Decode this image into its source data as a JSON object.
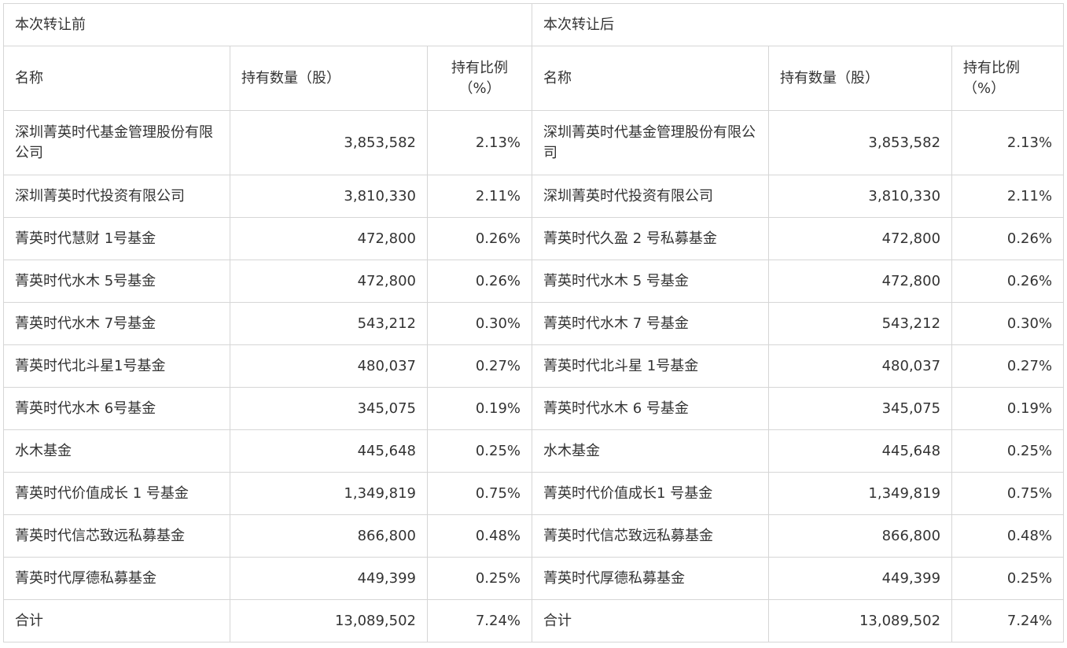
{
  "header": {
    "before": "本次转让前",
    "after": "本次转让后"
  },
  "subheader": {
    "name": "名称",
    "quantity": "持有数量（股）",
    "ratio_before": "持有比例（%）",
    "ratio_after": "持有比例（%）"
  },
  "rows": [
    {
      "before_name": "深圳菁英时代基金管理股份有限公司",
      "before_qty": "3,853,582",
      "before_pct": "2.13%",
      "after_name": "深圳菁英时代基金管理股份有限公司",
      "after_qty": "3,853,582",
      "after_pct": "2.13%"
    },
    {
      "before_name": "深圳菁英时代投资有限公司",
      "before_qty": "3,810,330",
      "before_pct": "2.11%",
      "after_name": "深圳菁英时代投资有限公司",
      "after_qty": "3,810,330",
      "after_pct": "2.11%"
    },
    {
      "before_name": "菁英时代慧财 1号基金",
      "before_qty": "472,800",
      "before_pct": "0.26%",
      "after_name": "菁英时代久盈 2 号私募基金",
      "after_qty": "472,800",
      "after_pct": "0.26%"
    },
    {
      "before_name": "菁英时代水木 5号基金",
      "before_qty": "472,800",
      "before_pct": "0.26%",
      "after_name": "菁英时代水木 5 号基金",
      "after_qty": "472,800",
      "after_pct": "0.26%"
    },
    {
      "before_name": "菁英时代水木 7号基金",
      "before_qty": "543,212",
      "before_pct": "0.30%",
      "after_name": "菁英时代水木 7 号基金",
      "after_qty": "543,212",
      "after_pct": "0.30%"
    },
    {
      "before_name": "菁英时代北斗星1号基金",
      "before_qty": "480,037",
      "before_pct": "0.27%",
      "after_name": "菁英时代北斗星 1号基金",
      "after_qty": "480,037",
      "after_pct": "0.27%"
    },
    {
      "before_name": "菁英时代水木 6号基金",
      "before_qty": "345,075",
      "before_pct": "0.19%",
      "after_name": "菁英时代水木 6 号基金",
      "after_qty": "345,075",
      "after_pct": "0.19%"
    },
    {
      "before_name": "水木基金",
      "before_qty": "445,648",
      "before_pct": "0.25%",
      "after_name": "水木基金",
      "after_qty": "445,648",
      "after_pct": "0.25%"
    },
    {
      "before_name": "菁英时代价值成长 1 号基金",
      "before_qty": "1,349,819",
      "before_pct": "0.75%",
      "after_name": "菁英时代价值成长1 号基金",
      "after_qty": "1,349,819",
      "after_pct": "0.75%"
    },
    {
      "before_name": "菁英时代信芯致远私募基金",
      "before_qty": "866,800",
      "before_pct": "0.48%",
      "after_name": "菁英时代信芯致远私募基金",
      "after_qty": "866,800",
      "after_pct": "0.48%"
    },
    {
      "before_name": "菁英时代厚德私募基金",
      "before_qty": "449,399",
      "before_pct": "0.25%",
      "after_name": "菁英时代厚德私募基金",
      "after_qty": "449,399",
      "after_pct": "0.25%"
    }
  ],
  "total": {
    "before_name": "合计",
    "before_qty": "13,089,502",
    "before_pct": "7.24%",
    "after_name": "合计",
    "after_qty": "13,089,502",
    "after_pct": "7.24%"
  }
}
